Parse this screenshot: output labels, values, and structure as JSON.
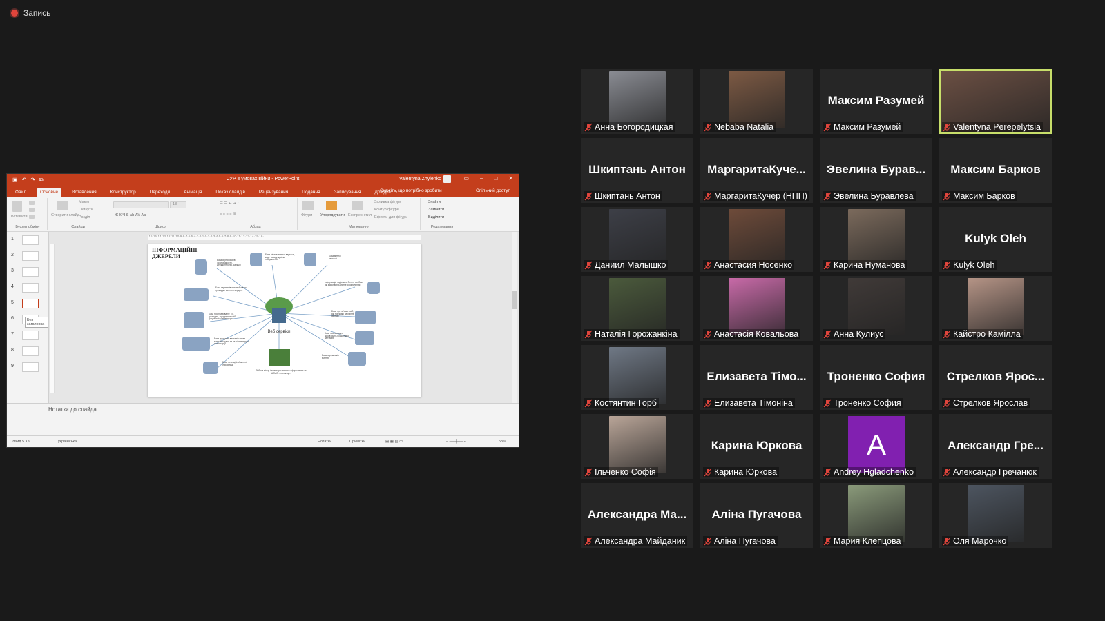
{
  "recording": {
    "label": "Запись"
  },
  "ppt": {
    "doc_title": "СУР в умовах війни - PowerPoint",
    "user": "Valentyna Zhylenko",
    "tabs": [
      "Файл",
      "Основне",
      "Вставлення",
      "Конструктор",
      "Переходи",
      "Анімація",
      "Показ слайдів",
      "Рецензування",
      "Подання",
      "Запису­вання",
      "Довідка"
    ],
    "tell_me": "Скажіть, що потрібно зробити",
    "share": "Спільний доступ",
    "ribbon": {
      "g1": "Буфер обміну",
      "g2": "Слайди",
      "g3": "Шрифт",
      "g4": "Абзац",
      "g5": "Малювання",
      "g6": "Редагування",
      "paste": "Вставити",
      "new_slide": "Створити слайд",
      "layout": "Макет",
      "reset": "Скинути",
      "section": "Розділ",
      "font_size": "18",
      "shapes": "Фігури",
      "arrange": "Упорядкувати",
      "quick_styles": "Експрес-стилі",
      "fill": "Заливка фігури",
      "outline": "Контур фігури",
      "effects": "Ефекти для фігури",
      "find": "Знайти",
      "replace": "Замінити",
      "select": "Виділити"
    },
    "ruler": "·16·15·14·13·12·11·10·9·8·7·6·5·4·3·2·1·0·1·2·3·4·5·6·7·8·9·10·11·12·13·14·15·16·",
    "slide_numbers": [
      "1",
      "2",
      "3",
      "4",
      "5",
      "6",
      "7",
      "8",
      "9"
    ],
    "tooltip": "Без заголовка",
    "slide": {
      "title": "ІНФОРМАЦІЙНІ ДЖЕРЕЛИ",
      "center": "Веб сервіси",
      "items": [
        "База сертифікатів (Відповідності), Держконтролю, санкцій",
        "База рішень митної вартості, коду товару, країни походження",
        "База митної вартості",
        "Інформація надіслана без по особам, які здійснюють митне оформлення",
        "База перетинів автомобілів та громадян митного кордону",
        "База про зв'язки осіб, які пов'язані на різних фірмах",
        "База про правова не ТЕ, громадян, юридичних осіб, документи, контейнери",
        "База невиконання зобов'язань по доставці вантажів",
        "База пропусків вантажів через митний кордон та на різних видах транспорту",
        "База порушників митних",
        "База потенційної митної інформації",
        "Робоча місце інспектора митного оформлення за АСМО «Інспектор»"
      ]
    },
    "notes": "Нотатки до слайда",
    "status": {
      "slide": "Слайд 5 з 9",
      "lang": "українська",
      "notes_btn": "Нотатки",
      "comments_btn": "Примітки",
      "zoom": "53%"
    }
  },
  "participants": [
    {
      "name": "Анна Богородицкая",
      "video": "photo",
      "color": "#8a8c93"
    },
    {
      "name": "Nebaba Natalia",
      "video": "photo",
      "color": "#7d5a44"
    },
    {
      "name": "Максим Разумей",
      "video": "none",
      "display": "Максим Разумей"
    },
    {
      "name": "Valentyna Perepelytsia",
      "video": "photo",
      "color": "#6b4f43",
      "speaking": true
    },
    {
      "name": "Шкиптань Антон",
      "video": "none",
      "display": "Шкиптань Антон"
    },
    {
      "name": "МаргаритаКучер (НПП)",
      "video": "none",
      "display": "МаргаритаКуче..."
    },
    {
      "name": "Эвелина Буравлева",
      "video": "none",
      "display": "Эвелина Бурав..."
    },
    {
      "name": "Максим Барков",
      "video": "none",
      "display": "Максим Барков"
    },
    {
      "name": "Даниил Малышко",
      "video": "photo",
      "color": "#3d3f47"
    },
    {
      "name": "Анастасия Носенко",
      "video": "photo",
      "color": "#6e4b3a"
    },
    {
      "name": "Карина Нуманова",
      "video": "photo",
      "color": "#7b6a5c"
    },
    {
      "name": "Kulyk Oleh",
      "video": "none",
      "display": "Kulyk Oleh"
    },
    {
      "name": "Наталія Горожанкіна",
      "video": "photo",
      "color": "#4b5a3c"
    },
    {
      "name": "Анастасія Ковальова",
      "video": "photo",
      "color": "#c86aa8"
    },
    {
      "name": "Анна Кулиус",
      "video": "photo",
      "color": "#403a38"
    },
    {
      "name": "Кайстро Камілла",
      "video": "photo",
      "color": "#b59486"
    },
    {
      "name": "Костянтин Горб",
      "video": "photo",
      "color": "#6f7885"
    },
    {
      "name": "Елизавета Тімонiна",
      "video": "none",
      "display": "Елизавета Тімо..."
    },
    {
      "name": "Троненко София",
      "video": "none",
      "display": "Троненко София"
    },
    {
      "name": "Стрелков Ярослав",
      "video": "none",
      "display": "Стрелков Ярос..."
    },
    {
      "name": "Ільченко Софія",
      "video": "photo",
      "color": "#b9a598"
    },
    {
      "name": "Карина Юркова",
      "video": "none",
      "display": "Карина Юркова"
    },
    {
      "name": "Andrey Hgladchenko",
      "video": "letter",
      "letter": "A"
    },
    {
      "name": "Александр Гречанюк",
      "video": "none",
      "display": "Александр Гре..."
    },
    {
      "name": "Александра Майданик",
      "video": "none",
      "display": "Александра Ма..."
    },
    {
      "name": "Аліна Пугачова",
      "video": "none",
      "display": "Аліна Пугачова"
    },
    {
      "name": "Мария Клепцова",
      "video": "photo",
      "color": "#8a9a7a"
    },
    {
      "name": "Оля Марочко",
      "video": "photo",
      "color": "#4d5560"
    }
  ],
  "colors": {
    "accent_ppt": "#c43e1c",
    "speaking_border": "#c7de6a",
    "muted_icon": "#e0453c",
    "tile_bg": "#262626"
  }
}
